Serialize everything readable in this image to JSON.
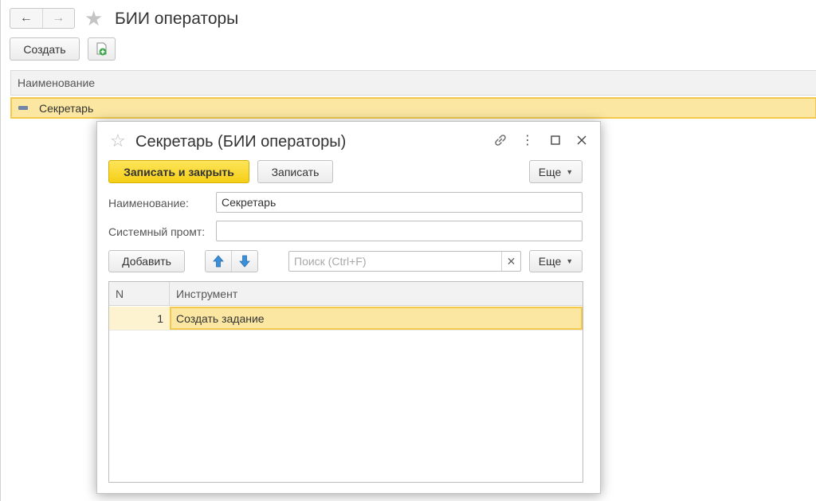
{
  "page": {
    "title": "БИИ операторы",
    "create_label": "Создать"
  },
  "list": {
    "column_header": "Наименование",
    "rows": [
      {
        "name": "Секретарь"
      }
    ]
  },
  "dialog": {
    "title": "Секретарь (БИИ операторы)",
    "save_close_label": "Записать и закрыть",
    "save_label": "Записать",
    "more_label": "Еще",
    "name_label": "Наименование:",
    "name_value": "Секретарь",
    "prompt_label": "Системный промт:",
    "prompt_value": "",
    "add_label": "Добавить",
    "search_placeholder": "Поиск (Ctrl+F)",
    "table_more_label": "Еще",
    "table": {
      "columns": [
        "N",
        "Инструмент"
      ],
      "rows": [
        {
          "n": "1",
          "tool": "Создать задание"
        }
      ]
    }
  },
  "colors": {
    "primary_button": "#f5cf16",
    "selected_row": "#fbe7a1",
    "selected_border": "#f2c94c",
    "arrow_blue": "#3b8fd9"
  },
  "icons": [
    "back-arrow-icon",
    "forward-arrow-icon",
    "favorite-star-icon",
    "create-copy-icon",
    "link-icon",
    "more-vertical-icon",
    "maximize-icon",
    "close-icon",
    "move-up-icon",
    "move-down-icon",
    "clear-icon",
    "dropdown-caret-icon"
  ]
}
